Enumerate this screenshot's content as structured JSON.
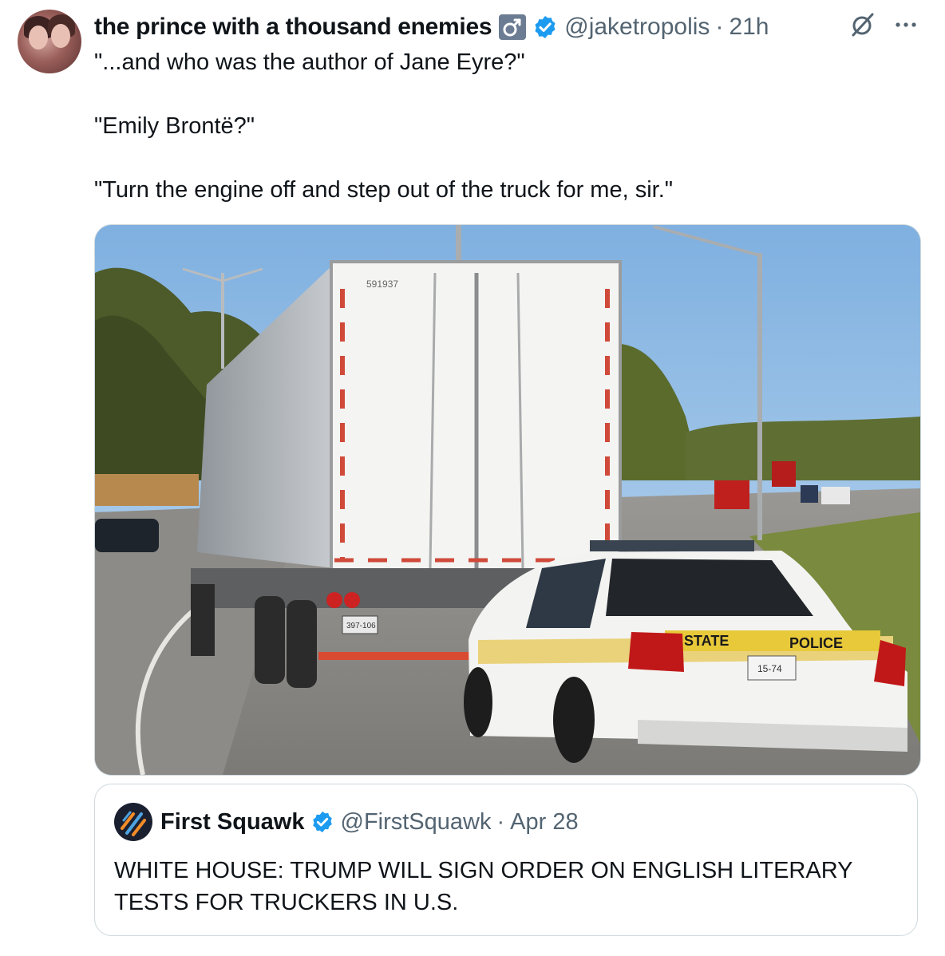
{
  "author": {
    "display_name": "the prince with a thousand enemies",
    "gender_symbol": "♂",
    "handle": "@jaketropolis",
    "separator": "·",
    "timestamp": "21h",
    "verified": true
  },
  "tweet": {
    "lines": [
      "\"...and who was the author of Jane Eyre?\"",
      "",
      "\"Emily Brontë?\"",
      "",
      "\"Turn the engine off and step out of the truck for me, sir.\""
    ]
  },
  "media": {
    "trailer_number": "591937",
    "car_label_left": "STATE",
    "car_label_right": "POLICE",
    "car_plate": "15-74",
    "truck_plate": "397-106"
  },
  "quoted_tweet": {
    "display_name": "First Squawk",
    "handle": "@FirstSquawk",
    "separator": "·",
    "timestamp": "Apr 28",
    "verified": true,
    "text": "WHITE HOUSE: TRUMP WILL SIGN ORDER ON ENGLISH LITERARY TESTS FOR TRUCKERS IN U.S."
  },
  "icons": {
    "verified_badge": "verified-badge-icon",
    "grok": "grok-icon",
    "more": "more-icon",
    "gender": "male-sign-icon"
  },
  "colors": {
    "verified_blue": "#1d9bf0",
    "secondary_text": "#536471",
    "primary_text": "#0f1419",
    "border": "#cfd9de"
  }
}
